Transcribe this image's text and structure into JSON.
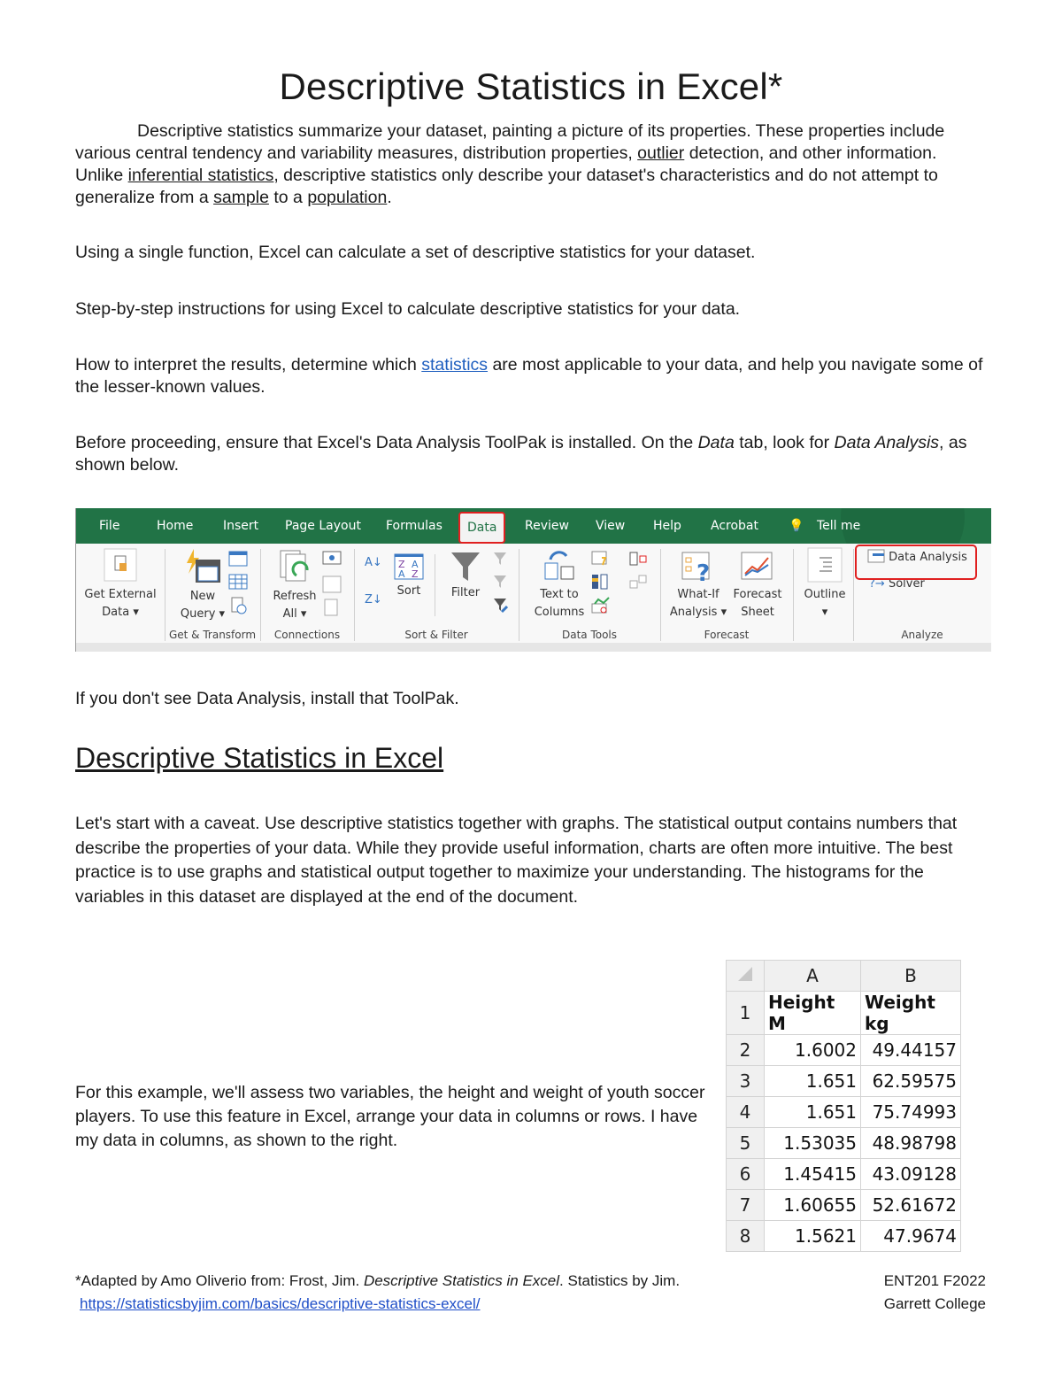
{
  "title": "Descriptive Statistics in Excel*",
  "intro": {
    "t1": "Descriptive statistics summarize your dataset, painting a picture of its properties. These properties include various central tendency and variability measures, distribution properties, ",
    "l1": "outlier",
    "t2": " detection, and other information. Unlike ",
    "l2": "inferential statistics",
    "t3": ", descriptive statistics only describe your dataset's characteristics and do not attempt to generalize from a ",
    "l3": "sample",
    "t4": " to a ",
    "l4": "population",
    "t5": "."
  },
  "p_single": "Using a single function, Excel can calculate a set of descriptive statistics for your dataset.",
  "p_steps": "Step-by-step instructions for using Excel to calculate descriptive statistics for your data.",
  "p_interpret": {
    "t1": "How to interpret the results, determine which ",
    "link": "statistics",
    "t2": " are most applicable to your data, and help you navigate some of the lesser-known values."
  },
  "p_before": {
    "t1": "Before proceeding, ensure that Excel's Data Analysis ToolPak is installed. On the ",
    "i1": "Data",
    "t2": " tab, look for ",
    "i2": "Data Analysis",
    "t3": ", as shown below."
  },
  "ribbon": {
    "tabs": [
      "File",
      "Home",
      "Insert",
      "Page Layout",
      "Formulas",
      "Data",
      "Review",
      "View",
      "Help",
      "Acrobat",
      "Tell me"
    ],
    "active_tab": "Data",
    "buttons": {
      "get_external": [
        "Get External",
        "Data ▾"
      ],
      "new_query": [
        "New",
        "Query ▾"
      ],
      "refresh": [
        "Refresh",
        "All ▾"
      ],
      "sort": "Sort",
      "filter": "Filter",
      "text_to_columns": [
        "Text to",
        "Columns"
      ],
      "what_if": [
        "What-If",
        "Analysis ▾"
      ],
      "forecast": [
        "Forecast",
        "Sheet"
      ],
      "outline": [
        "Outline",
        "▾"
      ],
      "data_analysis": "Data Analysis",
      "solver": "Solver"
    },
    "groups": [
      "Get & Transform",
      "Connections",
      "Sort & Filter",
      "Data Tools",
      "Forecast",
      "Analyze"
    ],
    "accent": "#217346",
    "highlight": "#e02020"
  },
  "p_install": "If you don't see Data Analysis, install that ToolPak.",
  "subheading": "Descriptive Statistics in Excel",
  "p_caveat": "Let's start with a caveat. Use descriptive statistics together with graphs. The statistical output contains numbers that describe the properties of your data. While they provide useful information, charts are often more intuitive. The best practice is to use graphs and statistical output together to maximize your understanding. The histograms for the variables in this dataset are displayed at the end of the document.",
  "p_example": "For this example, we'll assess two variables, the height and weight of youth soccer players. To use this feature in Excel, arrange your data in columns or rows. I have my data in columns, as shown to the right.",
  "sheet": {
    "columns": [
      "A",
      "B"
    ],
    "rows": [
      {
        "n": "1",
        "a": "Height M",
        "b": "Weight kg"
      },
      {
        "n": "2",
        "a": "1.6002",
        "b": "49.44157"
      },
      {
        "n": "3",
        "a": "1.651",
        "b": "62.59575"
      },
      {
        "n": "4",
        "a": "1.651",
        "b": "75.74993"
      },
      {
        "n": "5",
        "a": "1.53035",
        "b": "48.98798"
      },
      {
        "n": "6",
        "a": "1.45415",
        "b": "43.09128"
      },
      {
        "n": "7",
        "a": "1.60655",
        "b": "52.61672"
      },
      {
        "n": "8",
        "a": "1.5621",
        "b": "47.9674"
      }
    ]
  },
  "footer": {
    "t1": "*Adapted by Amo Oliverio from: Frost, Jim. ",
    "italic": "Descriptive Statistics in Excel",
    "t2": ". Statistics by Jim.",
    "url": "https://statisticsbyjim.com/basics/descriptive-statistics-excel/",
    "course": "ENT201 F2022",
    "college": "Garrett College"
  }
}
